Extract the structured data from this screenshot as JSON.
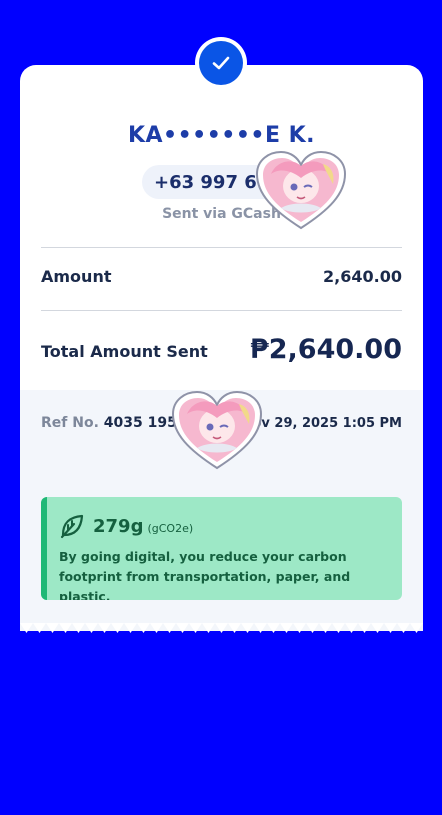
{
  "recipient": {
    "name": "KA•••••••E K.",
    "phone": "+63 997 613",
    "sent_via": "Sent via GCash"
  },
  "amount": {
    "label": "Amount",
    "value": "2,640.00"
  },
  "total": {
    "label": "Total Amount Sent",
    "value": "₱2,640.00"
  },
  "reference": {
    "prefix": "Ref No.",
    "number": "4035 195",
    "datetime": "Nov 29, 2025 1:05 PM"
  },
  "eco": {
    "amount": "279g",
    "unit": "(gCO2e)",
    "message": "By going digital, you reduce your carbon footprint from transportation, paper, and plastic.",
    "icon": "leaf-icon"
  },
  "icons": {
    "success": "check-icon",
    "sticker": "heart-sticker-icon"
  },
  "colors": {
    "background": "#0000ff",
    "accent": "#0a55e6",
    "eco_bg": "#9de8c6",
    "eco_bar": "#1fb876",
    "sticker_pink": "#f6b8cf"
  }
}
